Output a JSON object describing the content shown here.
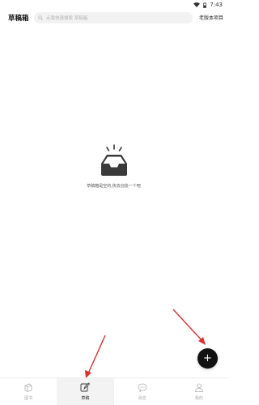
{
  "status_bar": {
    "time": "7:43",
    "icons": [
      "wifi-icon",
      "battery-icon"
    ]
  },
  "header": {
    "title": "草稿箱",
    "search_placeholder": "点我快速搜索 草稿箱",
    "right_link": "老版本项目"
  },
  "empty_state": {
    "icon": "inbox-tray-icon",
    "message": "草稿箱是空的,快去创造一个吧"
  },
  "tabs": [
    {
      "label": "图书",
      "icon": "book-icon",
      "active": false
    },
    {
      "label": "草稿",
      "icon": "edit-icon",
      "active": true
    },
    {
      "label": "消息",
      "icon": "chat-icon",
      "active": false
    },
    {
      "label": "我的",
      "icon": "person-icon",
      "active": false
    }
  ],
  "fab": {
    "label": "+"
  },
  "colors": {
    "accent": "#111111",
    "annotation_arrow": "#e03030"
  }
}
